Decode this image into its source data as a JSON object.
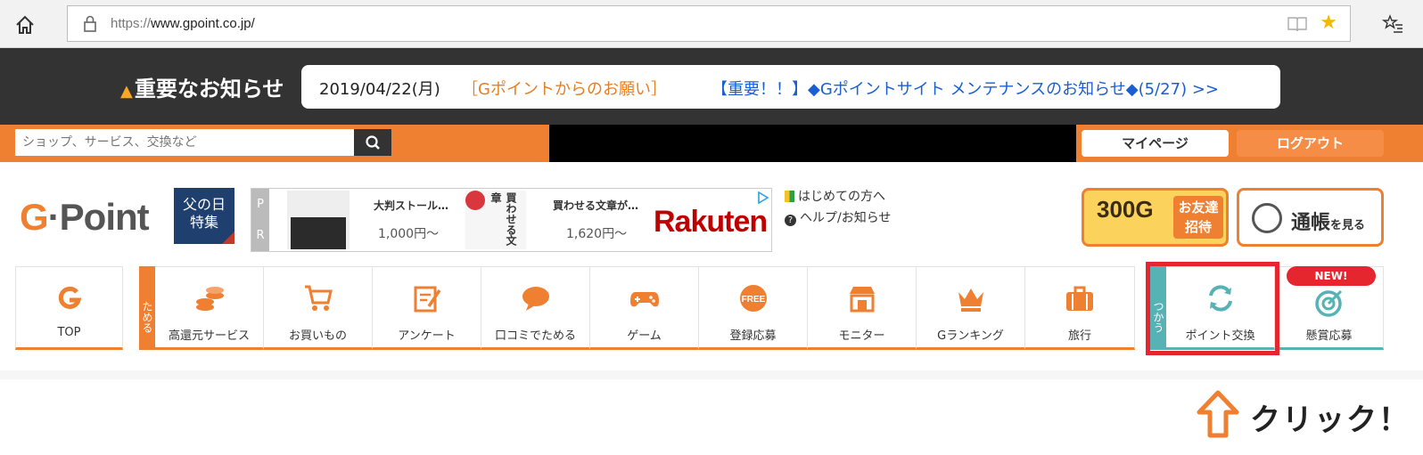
{
  "browser": {
    "url_protocol": "https://",
    "url_host": "www.gpoint.co.jp/"
  },
  "notice": {
    "title": "重要なお知らせ",
    "date": "2019/04/22(月)",
    "request": "［Gポイントからのお願い］",
    "link": "【重要！！】◆Gポイントサイト メンテナンスのお知らせ◆(5/27) >>"
  },
  "search": {
    "placeholder": "ショップ、サービス、交換など"
  },
  "header": {
    "mypage_label": "マイページ",
    "logout_label": "ログアウト"
  },
  "logo": {
    "text_g": "G",
    "text_rest": "·Point"
  },
  "fathers_day": {
    "line1": "父の日",
    "line2": "特集"
  },
  "ad": {
    "pr_p": "P",
    "pr_r": "R",
    "item1_title": "大判ストール…",
    "item1_price": "1,000円〜",
    "item2_title": "買わせる文章が…",
    "item2_price": "1,620円〜",
    "brand": "Rakuten",
    "book_text": "買わせる文章"
  },
  "help": {
    "first_time": "はじめての方へ",
    "help_news": "ヘルプ/お知らせ"
  },
  "banners": {
    "invite_amount": "300G",
    "invite_label_1": "お友達",
    "invite_label_2": "招待",
    "passbook_main": "通帳",
    "passbook_sub": "を見る"
  },
  "nav": {
    "top": "TOP",
    "earn_side": "ためる",
    "use_side": "つかう",
    "items": [
      {
        "label": "高還元サービス",
        "icon": "coins-icon"
      },
      {
        "label": "お買いもの",
        "icon": "cart-icon"
      },
      {
        "label": "アンケート",
        "icon": "survey-icon"
      },
      {
        "label": "口コミでためる",
        "icon": "speech-bubble-icon"
      },
      {
        "label": "ゲーム",
        "icon": "gamepad-icon"
      },
      {
        "label": "登録応募",
        "icon": "free-icon"
      },
      {
        "label": "モニター",
        "icon": "shop-icon"
      },
      {
        "label": "Gランキング",
        "icon": "crown-icon"
      },
      {
        "label": "旅行",
        "icon": "suitcase-icon"
      }
    ],
    "exchange": "ポイント交換",
    "prize": "懸賞応募",
    "new_badge": "NEW!",
    "free_text": "FREE"
  },
  "callout": {
    "text": "クリック！"
  },
  "colors": {
    "orange": "#ef7f31",
    "dark": "#333333",
    "teal": "#56b2b4",
    "highlight_red": "#e5262e",
    "link_blue": "#1a5fd1"
  }
}
